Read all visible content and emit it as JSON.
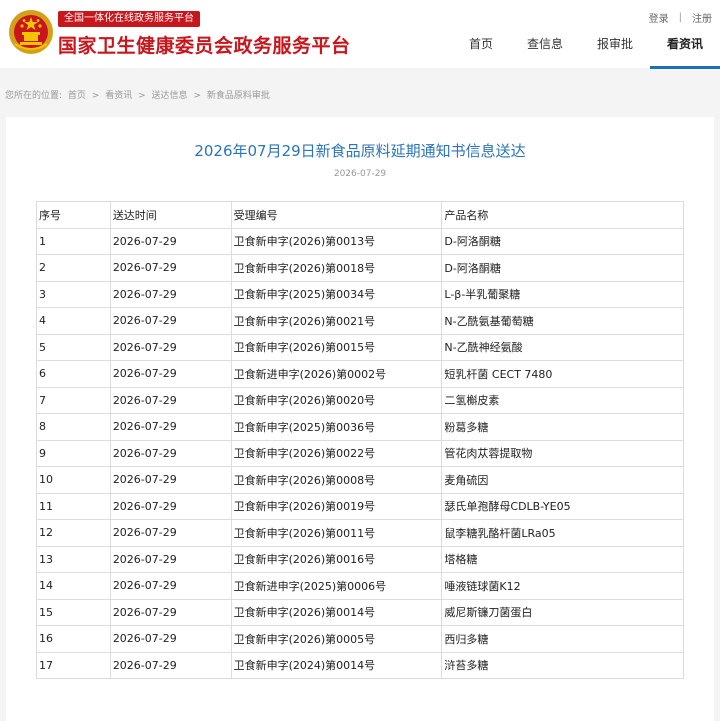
{
  "header": {
    "badge": "全国一体化在线政务服务平台",
    "site_title": "国家卫生健康委员会政务服务平台",
    "login": "登录",
    "separator": "|",
    "register": "注册",
    "nav": [
      "首页",
      "查信息",
      "报审批",
      "看资讯"
    ]
  },
  "breadcrumb": {
    "prefix": "您所在的位置:",
    "items": [
      "首页",
      "看资讯",
      "送达信息",
      "新食品原料审批"
    ],
    "sep": ">"
  },
  "article": {
    "title": "2026年07月29日新食品原料延期通知书信息送达",
    "date": "2026-07-29"
  },
  "table": {
    "headers": [
      "序号",
      "送达时间",
      "受理编号",
      "产品名称"
    ],
    "rows": [
      [
        "1",
        "2026-07-29",
        "卫食新申字(2026)第0013号",
        "D-阿洛酮糖"
      ],
      [
        "2",
        "2026-07-29",
        "卫食新申字(2026)第0018号",
        "D-阿洛酮糖"
      ],
      [
        "3",
        "2026-07-29",
        "卫食新申字(2025)第0034号",
        "L-β-半乳葡聚糖"
      ],
      [
        "4",
        "2026-07-29",
        "卫食新申字(2026)第0021号",
        "N-乙酰氨基葡萄糖"
      ],
      [
        "5",
        "2026-07-29",
        "卫食新申字(2026)第0015号",
        "N-乙酰神经氨酸"
      ],
      [
        "6",
        "2026-07-29",
        "卫食新进申字(2026)第0002号",
        "短乳杆菌 CECT 7480"
      ],
      [
        "7",
        "2026-07-29",
        "卫食新申字(2026)第0020号",
        "二氢槲皮素"
      ],
      [
        "8",
        "2026-07-29",
        "卫食新申字(2025)第0036号",
        "粉葛多糖"
      ],
      [
        "9",
        "2026-07-29",
        "卫食新申字(2026)第0022号",
        "管花肉苁蓉提取物"
      ],
      [
        "10",
        "2026-07-29",
        "卫食新申字(2026)第0008号",
        "麦角硫因"
      ],
      [
        "11",
        "2026-07-29",
        "卫食新申字(2026)第0019号",
        "瑟氏单孢酵母CDLB-YE05"
      ],
      [
        "12",
        "2026-07-29",
        "卫食新申字(2026)第0011号",
        "鼠李糖乳酪杆菌LRa05"
      ],
      [
        "13",
        "2026-07-29",
        "卫食新申字(2026)第0016号",
        "塔格糖"
      ],
      [
        "14",
        "2026-07-29",
        "卫食新进申字(2025)第0006号",
        "唾液链球菌K12"
      ],
      [
        "15",
        "2026-07-29",
        "卫食新申字(2026)第0014号",
        "威尼斯镰刀菌蛋白"
      ],
      [
        "16",
        "2026-07-29",
        "卫食新申字(2026)第0005号",
        "西归多糖"
      ],
      [
        "17",
        "2026-07-29",
        "卫食新申字(2024)第0014号",
        "浒苔多糖"
      ]
    ]
  }
}
